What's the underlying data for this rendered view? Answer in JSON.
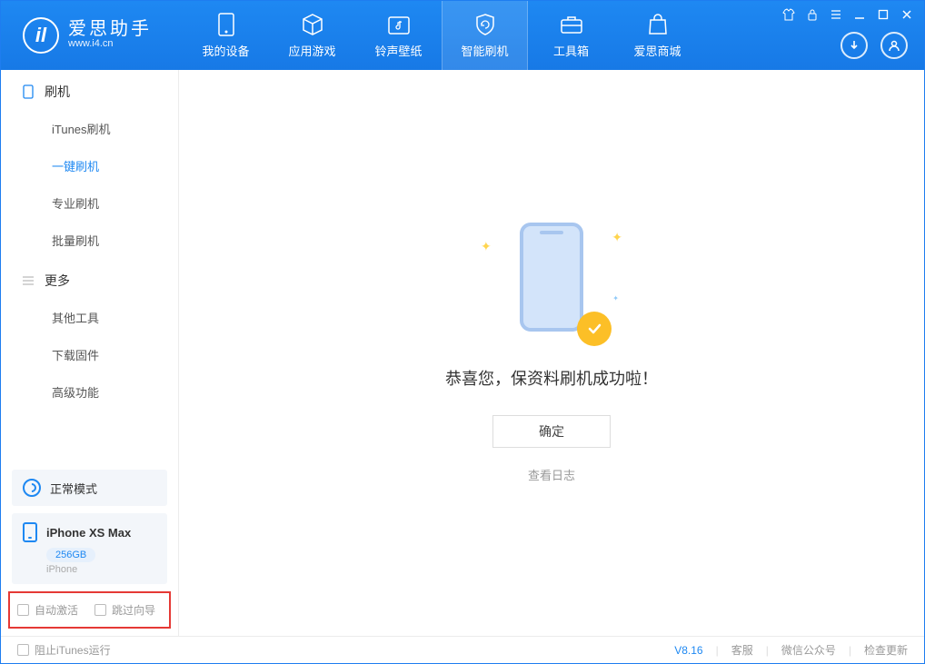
{
  "brand": {
    "name": "爱思助手",
    "url": "www.i4.cn"
  },
  "tabs": {
    "device": "我的设备",
    "apps": "应用游戏",
    "ringtone": "铃声壁纸",
    "flash": "智能刷机",
    "tools": "工具箱",
    "store": "爱思商城"
  },
  "sidebar": {
    "group1": {
      "title": "刷机",
      "items": {
        "itunes": "iTunes刷机",
        "oneclick": "一键刷机",
        "pro": "专业刷机",
        "batch": "批量刷机"
      }
    },
    "group2": {
      "title": "更多",
      "items": {
        "other": "其他工具",
        "firmware": "下载固件",
        "advanced": "高级功能"
      }
    },
    "status": "正常模式",
    "device": {
      "name": "iPhone XS Max",
      "storage": "256GB",
      "type": "iPhone"
    },
    "chk_activate": "自动激活",
    "chk_skip": "跳过向导"
  },
  "main": {
    "success": "恭喜您，保资料刷机成功啦！",
    "ok": "确定",
    "log": "查看日志"
  },
  "footer": {
    "stop_itunes": "阻止iTunes运行",
    "version": "V8.16",
    "support": "客服",
    "wechat": "微信公众号",
    "update": "检查更新"
  }
}
